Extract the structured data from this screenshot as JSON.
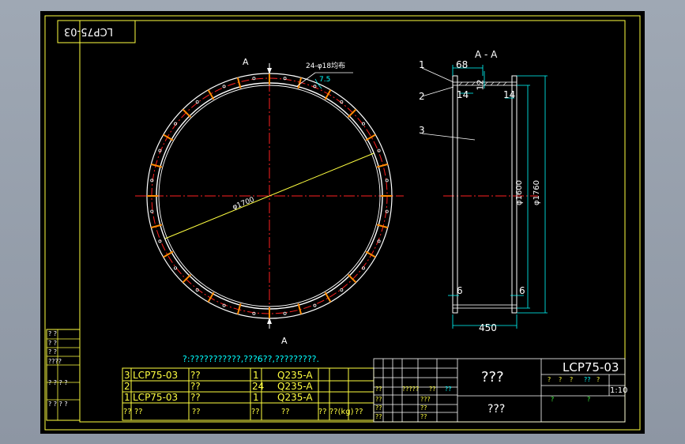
{
  "stamp_rotated": "LCP75-03",
  "section_title": "A - A",
  "section_mark_top": "A",
  "section_mark_bottom": "A",
  "bolt_note": "24-φ18均布",
  "bolt_angle": "7.5",
  "plan_diameter": "φ1700",
  "dimensions": {
    "flange_width": "68",
    "flange_thickness": "12",
    "left_wall": "14",
    "right_wall": "14",
    "inner_diameter": "φ1600",
    "outer_diameter": "φ1760",
    "bottom_left": "6",
    "bottom_right": "6",
    "height": "450"
  },
  "callouts": [
    "1",
    "2",
    "3"
  ],
  "note": "?:???????????,???6??,?????????.",
  "bom": {
    "rows": [
      {
        "no": "3",
        "code": "LCP75-03",
        "name": "??",
        "qty": "1",
        "material": "Q235-A"
      },
      {
        "no": "2",
        "code": "",
        "name": "??",
        "qty": "24",
        "material": "Q235-A"
      },
      {
        "no": "1",
        "code": "LCP75-03",
        "name": "??",
        "qty": "1",
        "material": "Q235-A"
      }
    ],
    "header": [
      "??",
      "??",
      "??",
      "??",
      "??",
      "??",
      "??(kg)",
      "??"
    ]
  },
  "title_block": {
    "drawing_no": "LCP75-03",
    "part_name": "???",
    "company": "???",
    "scale": "1:10",
    "mid_labels": [
      "??",
      "?????",
      "??",
      "??",
      "???",
      "??",
      "??",
      "??",
      "??",
      "??"
    ],
    "right_labels": [
      "?",
      "?",
      "?",
      "??",
      "?",
      "?",
      "?"
    ]
  },
  "left_strip_labels": [
    "? ?",
    "? ?",
    "? ?",
    "????",
    "? ? ? ?",
    "? ? ? ?"
  ],
  "colors": {
    "frame": "#ffff40",
    "center": "#ff2020",
    "bolt": "#ff7a00",
    "dim": "#00ffff",
    "text_green": "#40ff40"
  }
}
